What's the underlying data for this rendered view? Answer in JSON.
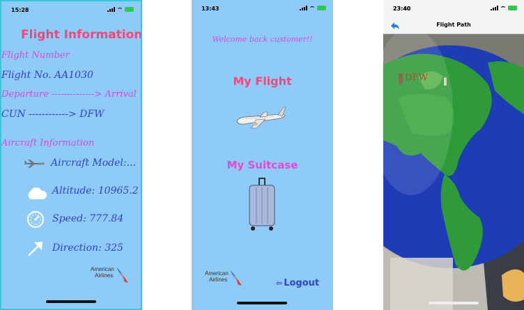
{
  "screens": {
    "flight_info": {
      "time": "15:28",
      "title": "Flight Information",
      "flight_number_label": "Flight Number",
      "flight_no": "Flight No. AA1030",
      "route_label": "Departure --------------> Arrival",
      "route": "CUN ------------> DFW",
      "aircraft_info_label": "Aircraft Information",
      "aircraft_model": "Aircraft Model:...",
      "altitude": "Altitude: 10965.2",
      "speed": "Speed: 777.84",
      "direction": "Direction: 325",
      "logo_line1": "American",
      "logo_line2": "Airlines",
      "icons": [
        "plane-icon",
        "cloud-icon",
        "speedometer-icon",
        "arrow-up-right-icon",
        "american-airlines-logo"
      ]
    },
    "menu": {
      "time": "13:43",
      "welcome": "Welcome back customer!!",
      "my_flight": "My Flight",
      "my_suitcase": "My Suitcase",
      "logout": "Logout",
      "logo_line1": "American",
      "logo_line2": "Airlines",
      "icons": [
        "airplane-image",
        "suitcase-image",
        "american-airlines-logo",
        "logout-arrow-icon"
      ]
    },
    "flight_path": {
      "time": "23:40",
      "nav_title": "Flight Path",
      "origin_label": "DFW",
      "icons": [
        "back-arrow-icon",
        "globe-image",
        "plane-marker-icon"
      ]
    }
  },
  "colors": {
    "screen_bg": "#8ecbf9",
    "title_red": "#f0497a",
    "label_magenta": "#d44bd9",
    "value_blue": "#3144c8",
    "ios_blue": "#1d7ff0"
  }
}
